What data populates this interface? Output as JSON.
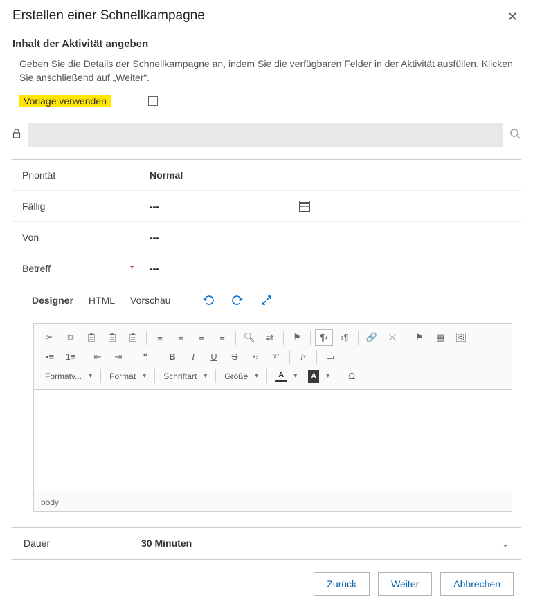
{
  "header": {
    "title": "Erstellen einer Schnellkampagne"
  },
  "subtitle": "Inhalt der Aktivität angeben",
  "instructions": "Geben Sie die Details der Schnellkampagne an, indem Sie die verfügbaren Felder in der Aktivität ausfüllen. Klicken Sie anschließend auf „Weiter“.",
  "template_label": "Vorlage verwenden",
  "fields": {
    "priority": {
      "label": "Priorität",
      "value": "Normal"
    },
    "due": {
      "label": "Fällig",
      "value": "---"
    },
    "from": {
      "label": "Von",
      "value": "---"
    },
    "subject": {
      "label": "Betreff",
      "value": "---",
      "required_mark": "*"
    }
  },
  "editor": {
    "tabs": {
      "designer": "Designer",
      "html": "HTML",
      "preview": "Vorschau"
    },
    "dropdowns": {
      "format_style": "Formatv...",
      "format": "Format",
      "font": "Schriftart",
      "size": "Größe"
    },
    "path": "body"
  },
  "duration": {
    "label": "Dauer",
    "value": "30 Minuten"
  },
  "footer": {
    "back": "Zurück",
    "next": "Weiter",
    "cancel": "Abbrechen"
  }
}
